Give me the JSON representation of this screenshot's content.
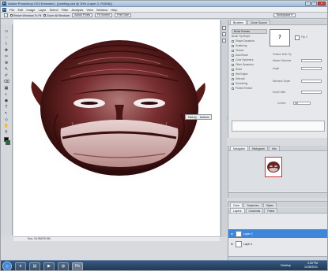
{
  "window": {
    "title": "Adobe Photoshop CS3 Extended - [painting.psd @ 30% (Layer 2, RGB/8)]",
    "app_icon": "Ps",
    "controls": [
      "–",
      "□",
      "X"
    ]
  },
  "menu": [
    "File",
    "Edit",
    "Image",
    "Layer",
    "Select",
    "Filter",
    "Analysis",
    "View",
    "Window",
    "Help"
  ],
  "options": {
    "resize_windows": "Resize Windows To Fit",
    "zoom_all": "Zoom All Windows",
    "actual_pixels": "Actual Pixels",
    "fit_screen": "Fit Screen",
    "print_size": "Print Size",
    "workspace": "Workspace ▾"
  },
  "tools": [
    "▭",
    "◌",
    "⌇",
    "✥",
    "✂",
    "⊕",
    "✎",
    "✐",
    "⌫",
    "▦",
    "◐",
    "◉",
    "T",
    "↖",
    "◇",
    "✋",
    "⚲"
  ],
  "canvas": {
    "status_text": "Doc: 24.9M/29.0M"
  },
  "floating": {
    "history": "History",
    "actions": "Actions"
  },
  "brushes": {
    "tabs": [
      "Brushes",
      "Clone Source"
    ],
    "list": [
      "Brush Presets",
      "Brush Tip Shape",
      "Shape Dynamics",
      "Scattering",
      "Texture",
      "Dual Brush",
      "Color Dynamics",
      "Other Dynamics",
      "Noise",
      "Wet Edges",
      "Airbrush",
      "Smoothing",
      "Protect Texture"
    ],
    "preset_value": "7",
    "labels": [
      "Flip X",
      "Feature Both Tip",
      "Master Diameter",
      "Angle",
      "Minimum Depth",
      "Depth Jitter",
      "Control"
    ],
    "control_value": "Off"
  },
  "navigator": {
    "tabs": [
      "Navigator",
      "Histogram",
      "Info"
    ]
  },
  "color": {
    "tabs": [
      "Color",
      "Swatches",
      "Styles"
    ]
  },
  "layers": {
    "tabs": [
      "Layers",
      "Channels",
      "Paths"
    ],
    "rows": [
      {
        "name": "Layer 2",
        "selected": true
      },
      {
        "name": "Layer 1",
        "selected": false
      }
    ]
  },
  "taskbar": {
    "desktop": "Desktop",
    "time": "3:28 PM",
    "date": "11/08/2011",
    "apps": [
      "e",
      "▤",
      "▶",
      "◍",
      "Ps"
    ]
  }
}
